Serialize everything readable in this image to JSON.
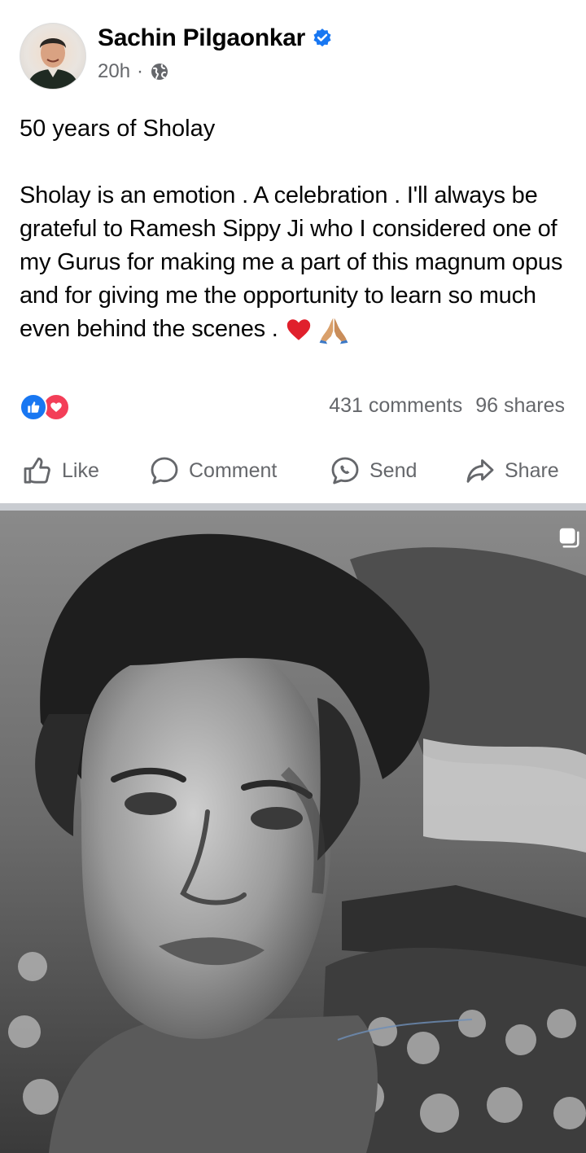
{
  "post": {
    "author": "Sachin Pilgaonkar",
    "time": "20h",
    "separator_dot": "·",
    "title": "50 years of Sholay",
    "body": "Sholay is an emotion . A celebration .  I'll always be grateful to Ramesh Sippy Ji who I considered one of my Gurus for making me a part of this magnum opus and for giving me the opportunity to learn so much even behind the scenes .",
    "trailing_emojis": [
      "heart",
      "folded-hands"
    ],
    "comments": "431 comments",
    "shares": "96 shares"
  },
  "actions": {
    "like": "Like",
    "comment": "Comment",
    "send": "Send",
    "share": "Share"
  },
  "colors": {
    "brand_blue": "#1877f2",
    "love_red": "#f33e58",
    "secondary_text": "#65676b",
    "separator": "#c9ccd1"
  },
  "icons": [
    "verified-badge-icon",
    "globe-icon",
    "like-reaction-icon",
    "love-reaction-icon",
    "thumbs-up-icon",
    "comment-bubble-icon",
    "messenger-icon",
    "share-arrow-icon",
    "multi-photo-icon"
  ]
}
